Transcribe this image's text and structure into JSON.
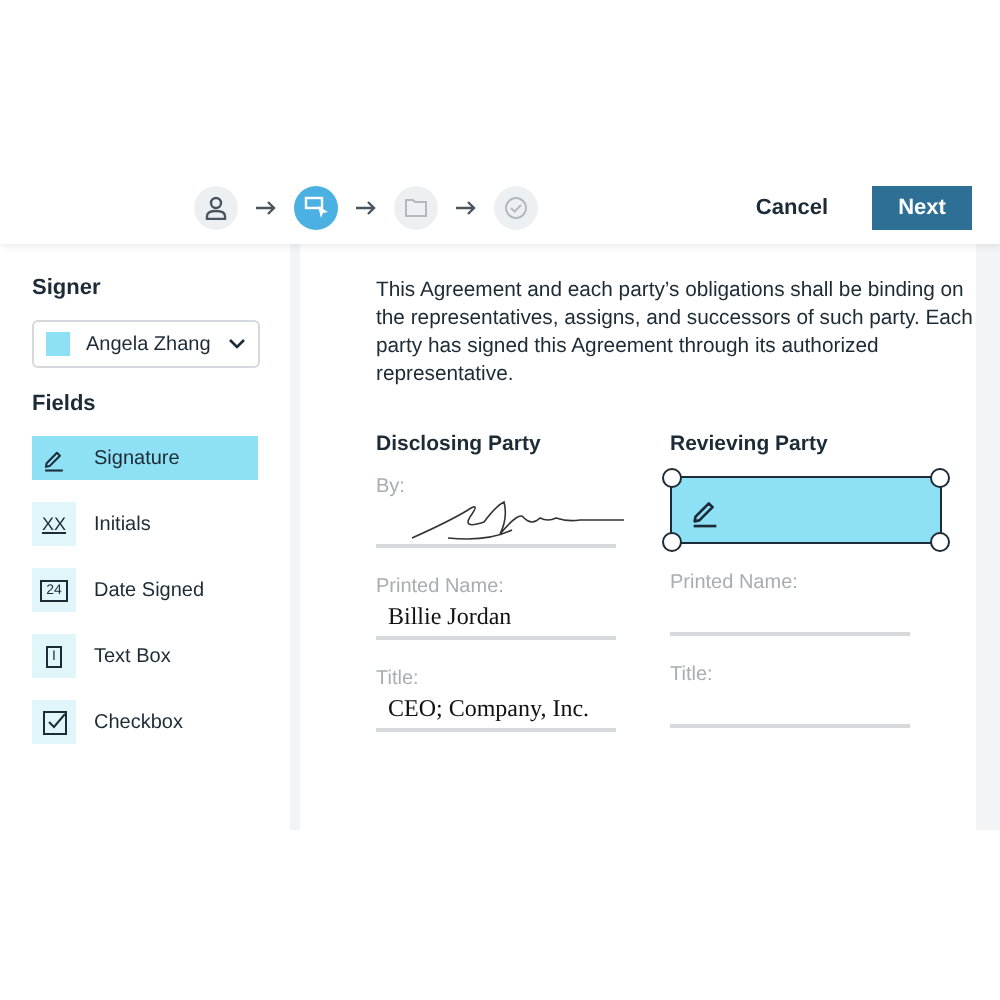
{
  "steps": [
    {
      "kind": "person",
      "selected": false
    },
    {
      "kind": "fields",
      "selected": true
    },
    {
      "kind": "folder",
      "selected": false
    },
    {
      "kind": "check",
      "selected": false
    }
  ],
  "actions": {
    "cancel": "Cancel",
    "next": "Next"
  },
  "sidebar": {
    "signer_label": "Signer",
    "signer": {
      "name": "Angela Zhang",
      "color": "#8ee0f5"
    },
    "fields_label": "Fields",
    "fields": [
      {
        "kind": "signature",
        "label": "Signature",
        "selected": true
      },
      {
        "kind": "initials",
        "label": "Initials",
        "icon_text": "XX",
        "selected": false
      },
      {
        "kind": "date",
        "label": "Date Signed",
        "icon_text": "24",
        "selected": false
      },
      {
        "kind": "textbox",
        "label": "Text Box",
        "icon_text": "I",
        "selected": false
      },
      {
        "kind": "checkbox",
        "label": "Checkbox",
        "selected": false
      }
    ]
  },
  "document": {
    "paragraph": "This Agreement and each party’s obligations shall be binding on the representatives, assigns, and successors of such party. Each party has signed this Agreement through its authorized representative.",
    "parties": [
      {
        "heading": "Disclosing Party",
        "signature": {
          "kind": "signed",
          "label": "By:"
        },
        "name_label": "Printed Name:",
        "name": "Billie Jordan",
        "title_label": "Title:",
        "title": "CEO; Company, Inc."
      },
      {
        "heading": "Revieving Party",
        "signature": {
          "kind": "field",
          "selected": true
        },
        "name_label": "Printed Name:",
        "title_label": "Title:"
      }
    ]
  }
}
